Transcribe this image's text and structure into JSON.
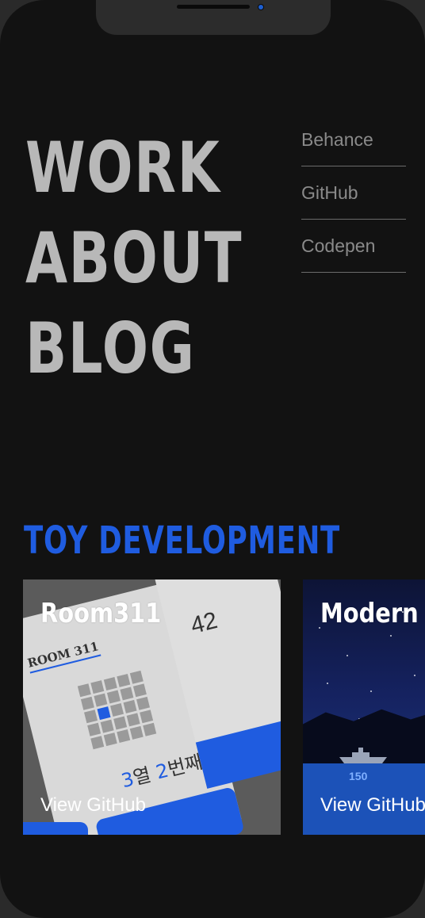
{
  "nav": {
    "main": [
      "WORK",
      "ABOUT",
      "BLOG"
    ],
    "social": [
      "Behance",
      "GitHub",
      "Codepen"
    ]
  },
  "section": {
    "title": "TOY DEVELOPMENT"
  },
  "projects": [
    {
      "title": "Room311",
      "link": "View GitHub",
      "mockup": {
        "heading": "ROOM 311",
        "seat_a": "3",
        "seat_mid": "열 ",
        "seat_b": "2",
        "seat_end": "번째",
        "count": "42"
      }
    },
    {
      "title": "Modern F",
      "link": "View GitHub",
      "game": {
        "score": "150"
      }
    }
  ],
  "colors": {
    "accent": "#1f5ce0",
    "background": "#121212",
    "nav_text": "#b8b8b8"
  },
  "icons": [
    "speaker-icon",
    "camera-icon"
  ]
}
